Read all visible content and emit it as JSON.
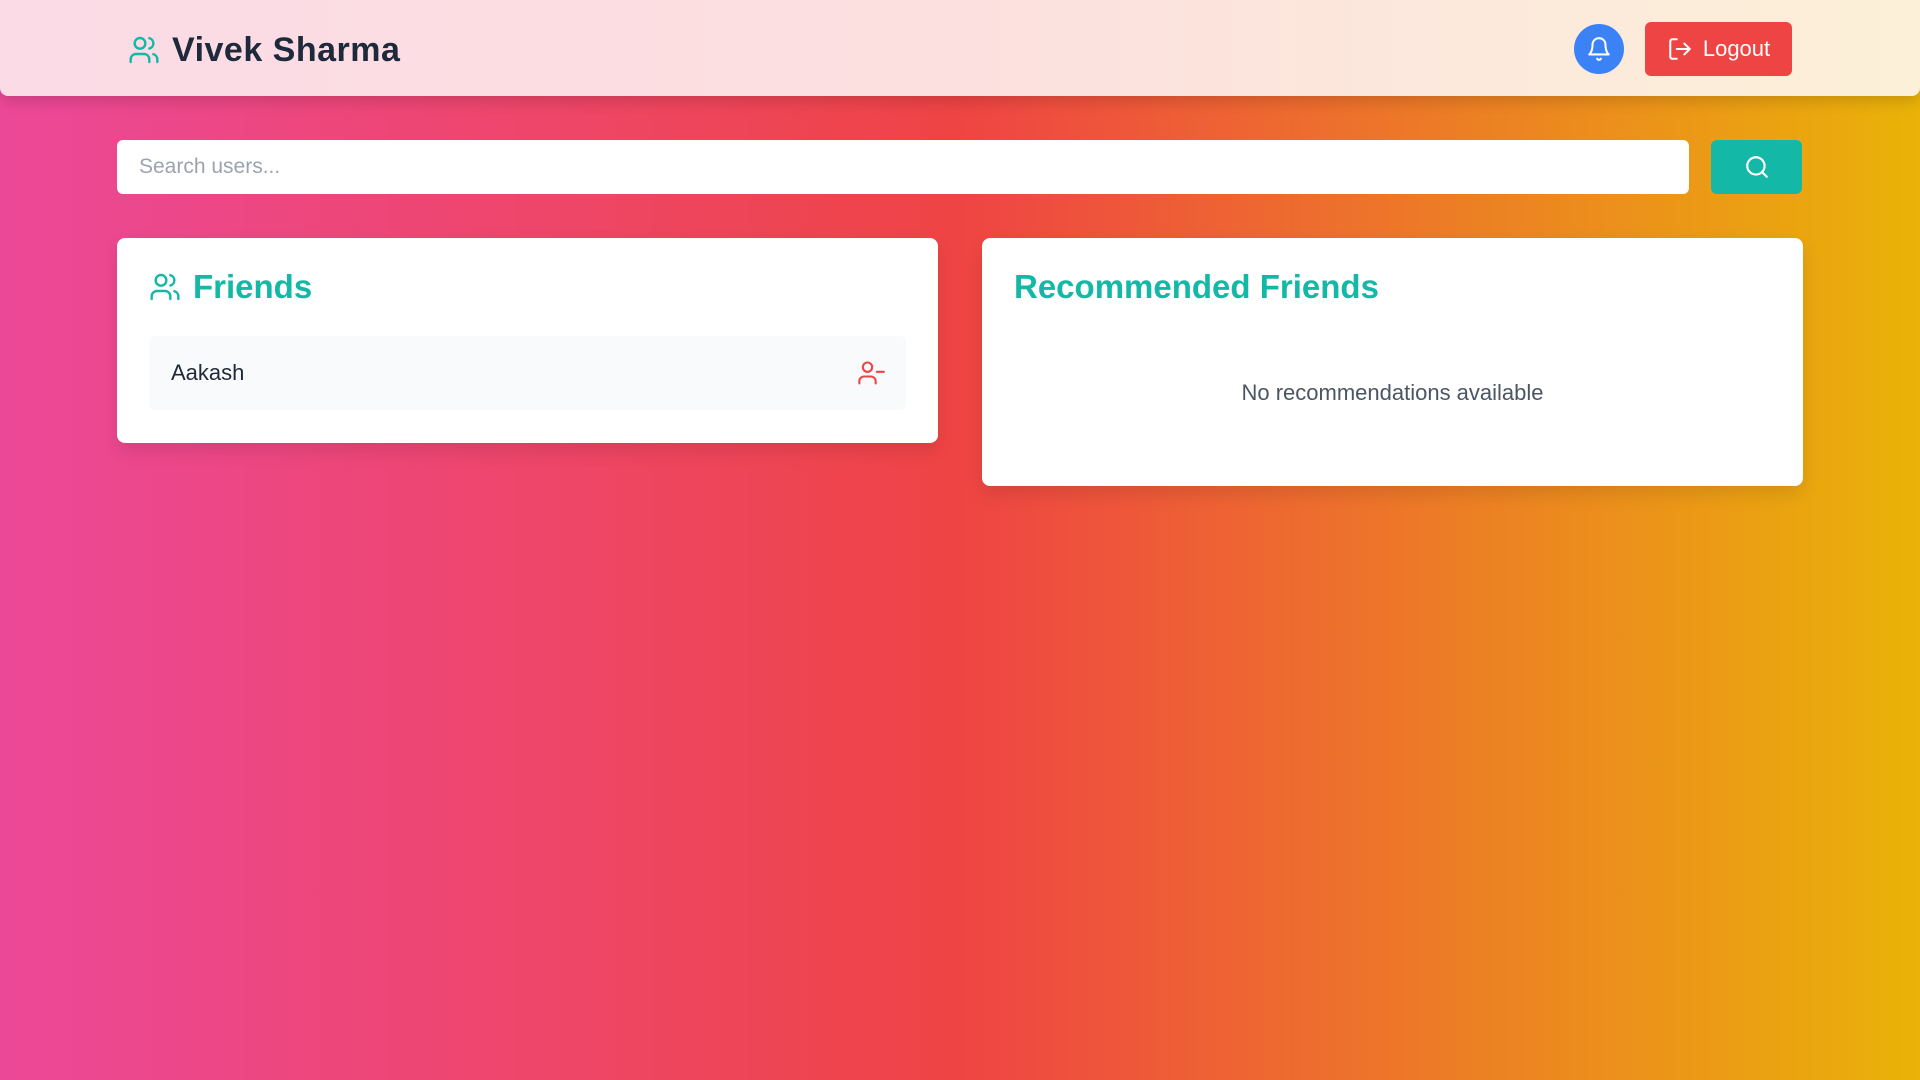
{
  "header": {
    "user_name": "Vivek Sharma",
    "brand_icon": "users-icon",
    "notifications_icon": "bell-icon",
    "logout_label": "Logout",
    "logout_icon": "logout-icon"
  },
  "search": {
    "placeholder": "Search users...",
    "value": "",
    "button_icon": "search-icon"
  },
  "friends": {
    "title": "Friends",
    "title_icon": "users-icon",
    "items": [
      {
        "name": "Aakash",
        "action_icon": "user-minus-icon"
      }
    ]
  },
  "recommended": {
    "title": "Recommended Friends",
    "empty_message": "No recommendations available"
  },
  "colors": {
    "accent": "#14b8a6",
    "danger": "#ef4444",
    "notification": "#3b82f6",
    "heading_dark": "#1e293b",
    "background_gradient": [
      "#ec4899",
      "#ef4444",
      "#eab308"
    ]
  }
}
